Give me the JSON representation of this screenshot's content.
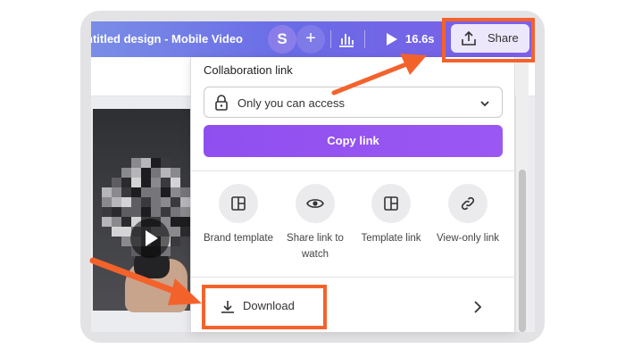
{
  "header": {
    "title": "ntitled design - Mobile Video",
    "avatar_initial": "S",
    "add_label": "+",
    "play_time": "16.6s",
    "share_label": "Share"
  },
  "share_panel": {
    "collab_label": "Collaboration link",
    "access_value": "Only you can access",
    "copy_button": "Copy link",
    "options": [
      {
        "icon": "brand-template-icon",
        "label": "Brand template"
      },
      {
        "icon": "eye-icon",
        "label": "Share link to watch"
      },
      {
        "icon": "template-link-icon",
        "label": "Template link"
      },
      {
        "icon": "link-icon",
        "label": "View-only link"
      }
    ],
    "download_label": "Download"
  },
  "colors": {
    "accent": "#8f4ff0",
    "highlight": "#f4622c",
    "topbar": "#6a6be6"
  }
}
